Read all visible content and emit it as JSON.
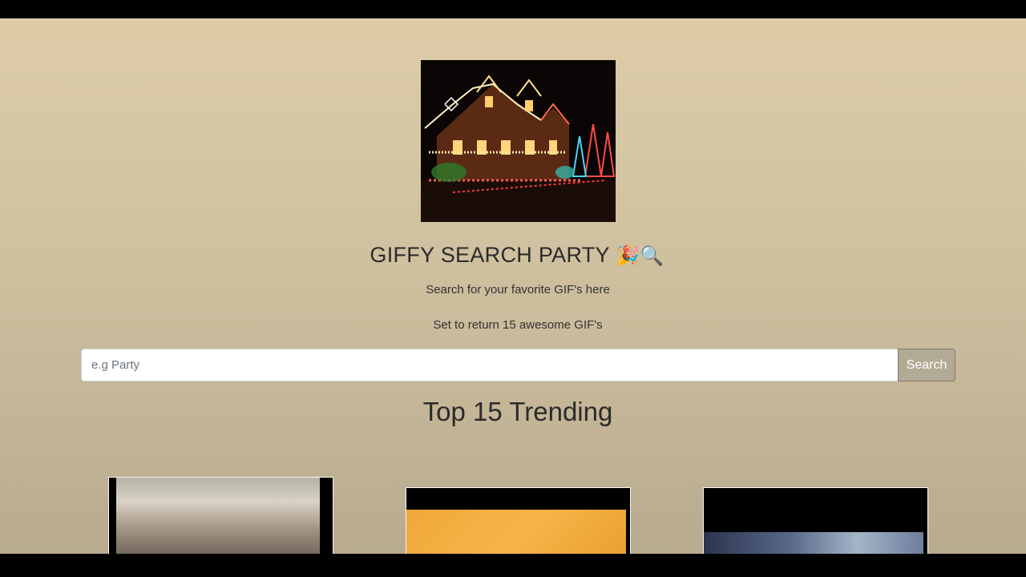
{
  "header": {
    "title": "GIFFY SEARCH PARTY",
    "title_emojis": "🎉🔍",
    "subtitle": "Search for your favorite GIF's here",
    "subtitle2": "Set to return 15 awesome GIF's"
  },
  "hero_image": {
    "alt": "house-with-christmas-lights-image"
  },
  "search": {
    "placeholder": "e.g Party",
    "value": "",
    "button_label": "Search"
  },
  "trending": {
    "heading": "Top 15 Trending"
  },
  "colors": {
    "background_top": "#decca7",
    "background_bottom": "#b8ab8e",
    "button_bg": "#b3aa95"
  }
}
